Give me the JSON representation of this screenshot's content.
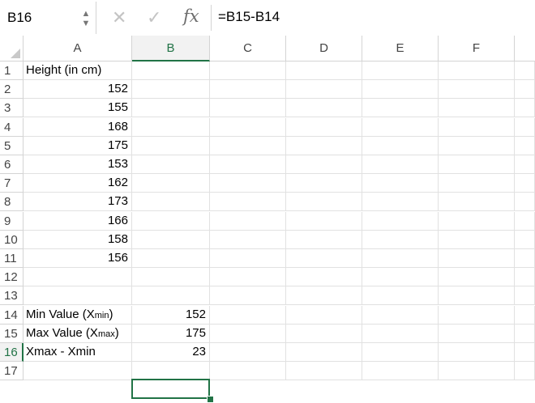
{
  "formula_bar": {
    "name_box": "B16",
    "fx_label": "fx",
    "formula": "=B15-B14",
    "cancel_glyph": "✕",
    "enter_glyph": "✓"
  },
  "columns": [
    "A",
    "B",
    "C",
    "D",
    "E",
    "F"
  ],
  "selected_column": "B",
  "rows": [
    "1",
    "2",
    "3",
    "4",
    "5",
    "6",
    "7",
    "8",
    "9",
    "10",
    "11",
    "12",
    "13",
    "14",
    "15",
    "16",
    "17"
  ],
  "selected_row": "16",
  "cells": {
    "A1": "Height (in cm)",
    "A2": "152",
    "A3": "155",
    "A4": "168",
    "A5": "175",
    "A6": "153",
    "A7": "162",
    "A8": "173",
    "A9": "166",
    "A10": "158",
    "A11": "156",
    "A14_main": "Min Value (X",
    "A14_sub": "min",
    "A14_end": ")",
    "A15_main": "Max Value (X",
    "A15_sub": "max",
    "A15_end": ")",
    "A16": "Xmax - Xmin",
    "B14": "152",
    "B15": "175",
    "B16": "23"
  },
  "colors": {
    "accent": "#217346",
    "grid": "#e1e1e1",
    "header_border": "#d4d4d4"
  }
}
